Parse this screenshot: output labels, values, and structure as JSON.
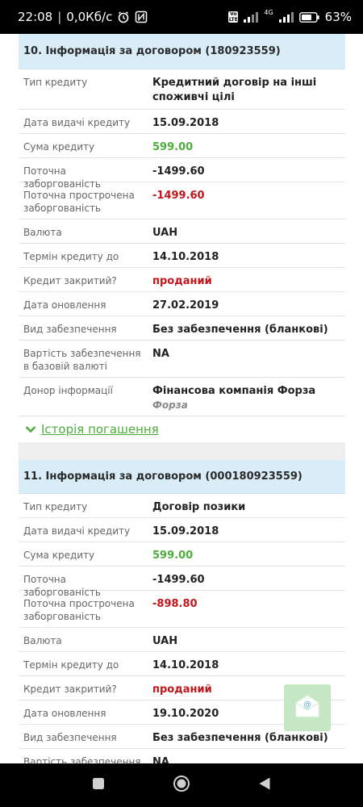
{
  "status_bar": {
    "time": "22:08",
    "speed": "0,0Кб/с",
    "separator": "|",
    "network_badge": "4G",
    "volte": "Vo LTE",
    "battery": "63%"
  },
  "contracts": [
    {
      "header": "10. Інформація за договором (180923559)",
      "rows": [
        {
          "label": "Тип кредиту",
          "value": "Кредитний договір на інші споживчі цілі",
          "style": "normal"
        },
        {
          "label": "Дата видачі кредиту",
          "value": "15.09.2018",
          "style": "normal"
        },
        {
          "label": "Сума кредиту",
          "value": "599.00",
          "style": "green"
        },
        {
          "label": "Поточна заборгованість",
          "value": "-1499.60",
          "style": "normal"
        },
        {
          "label": "Поточна прострочена заборгованість",
          "value": "-1499.60",
          "style": "red"
        },
        {
          "label": "Валюта",
          "value": "UAH",
          "style": "normal"
        },
        {
          "label": "Термін кредиту до",
          "value": "14.10.2018",
          "style": "normal"
        },
        {
          "label": "Кредит закритий?",
          "value": "проданий",
          "style": "red"
        },
        {
          "label": "Дата оновлення",
          "value": "27.02.2019",
          "style": "normal"
        },
        {
          "label": "Вид забезпечення",
          "value": "Без забезпечення (бланкові)",
          "style": "normal"
        },
        {
          "label": "Вартість забезпечення в базовій валюті",
          "value": "NA",
          "style": "normal"
        },
        {
          "label": "Донор інформації",
          "value": "Фінансова компанія Форза",
          "sub": "Форза",
          "style": "normal"
        }
      ],
      "history_link": "Історія погашення"
    },
    {
      "header": "11. Інформація за договором (000180923559)",
      "rows": [
        {
          "label": "Тип кредиту",
          "value": "Договір позики",
          "style": "normal"
        },
        {
          "label": "Дата видачі кредиту",
          "value": "15.09.2018",
          "style": "normal"
        },
        {
          "label": "Сума кредиту",
          "value": "599.00",
          "style": "green"
        },
        {
          "label": "Поточна заборгованість",
          "value": "-1499.60",
          "style": "normal"
        },
        {
          "label": "Поточна прострочена заборгованість",
          "value": "-898.80",
          "style": "red"
        },
        {
          "label": "Валюта",
          "value": "UAH",
          "style": "normal"
        },
        {
          "label": "Термін кредиту до",
          "value": "14.10.2018",
          "style": "normal"
        },
        {
          "label": "Кредит закритий?",
          "value": "проданий",
          "style": "red"
        },
        {
          "label": "Дата оновлення",
          "value": "19.10.2020",
          "style": "normal"
        },
        {
          "label": "Вид забезпечення",
          "value": "Без забезпечення (бланкові)",
          "style": "normal"
        },
        {
          "label": "Вартість забезпечення в базовій валюті",
          "value": "NA",
          "style": "normal"
        }
      ]
    }
  ],
  "icons": {
    "alarm": "alarm-icon",
    "nfc": "nfc-icon",
    "signal": "signal-icon",
    "battery": "battery-icon",
    "history_chevron": "chevron-down-icon",
    "mail": "mail-icon",
    "nav_recent": "square-icon",
    "nav_home": "circle-icon",
    "nav_back": "triangle-back-icon"
  },
  "colors": {
    "header_bg": "#d8edf7",
    "green": "#4cae3b",
    "red": "#c0161b"
  }
}
